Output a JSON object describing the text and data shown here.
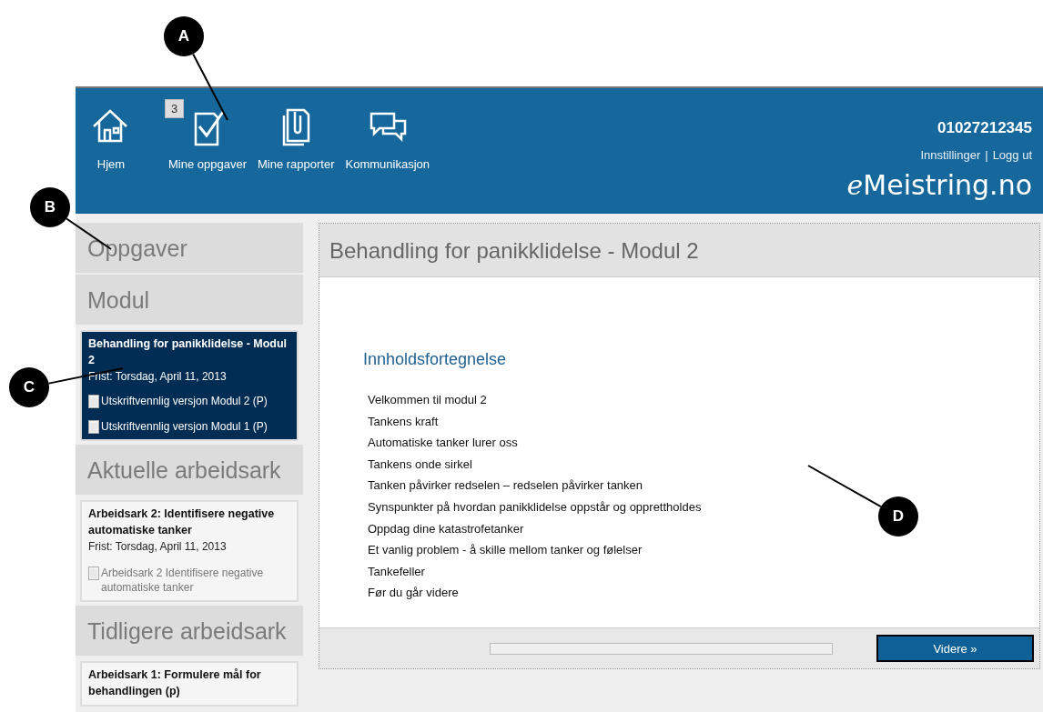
{
  "header": {
    "nav": [
      {
        "kind": "home",
        "label": "Hjem"
      },
      {
        "kind": "tasks",
        "label": "Mine oppgaver",
        "badge": "3"
      },
      {
        "kind": "reports",
        "label": "Mine rapporter"
      },
      {
        "kind": "chat",
        "label": "Kommunikasjon"
      }
    ],
    "user_id": "01027212345",
    "links": [
      "Innstillinger",
      "Logg ut"
    ],
    "separator": "|",
    "logo": {
      "prefix": "e",
      "name": "Meistring.no"
    }
  },
  "sidebar": {
    "sections": [
      {
        "heading": "Oppgaver"
      },
      {
        "heading": "Modul",
        "cards": [
          {
            "title": "Behandling for panikklidelse - Modul 2",
            "due": "Frist: Torsdag, April 11, 2013",
            "selected": true,
            "files": [
              "Utskriftvennlig versjon Modul 2 (P)",
              "Utskriftvennlig versjon Modul 1 (P)"
            ]
          }
        ]
      },
      {
        "heading": "Aktuelle arbeidsark",
        "cards": [
          {
            "title": "Arbeidsark 2: Identifisere negative automatiske tanker",
            "due": "Frist: Torsdag, April 11, 2013",
            "selected": false,
            "files": [
              "Arbeidsark 2 Identifisere negative automatiske tanker"
            ]
          }
        ]
      },
      {
        "heading": "Tidligere arbeidsark",
        "cards": [
          {
            "title": "Arbeidsark 1: Formulere mål for behandlingen (p)",
            "selected": false
          }
        ]
      }
    ]
  },
  "main": {
    "title": "Behandling for panikklidelse - Modul 2",
    "toc_heading": "Innholdsfortegnelse",
    "toc": [
      "Velkommen til modul 2",
      "Tankens kraft",
      "Automatiske tanker lurer oss",
      "Tankens onde sirkel",
      "Tanken påvirker redselen – redselen påvirker tanken",
      "Synspunkter på hvordan panikklidelse oppstår og opprettholdes",
      "Oppdag dine katastrofetanker",
      "Et vanlig problem - å skille mellom tanker og følelser",
      "Tankefeller",
      "Før du går videre"
    ],
    "progress": {
      "level": 0
    },
    "next_button": "Videre »"
  },
  "callouts": [
    "A",
    "B",
    "C",
    "D"
  ]
}
